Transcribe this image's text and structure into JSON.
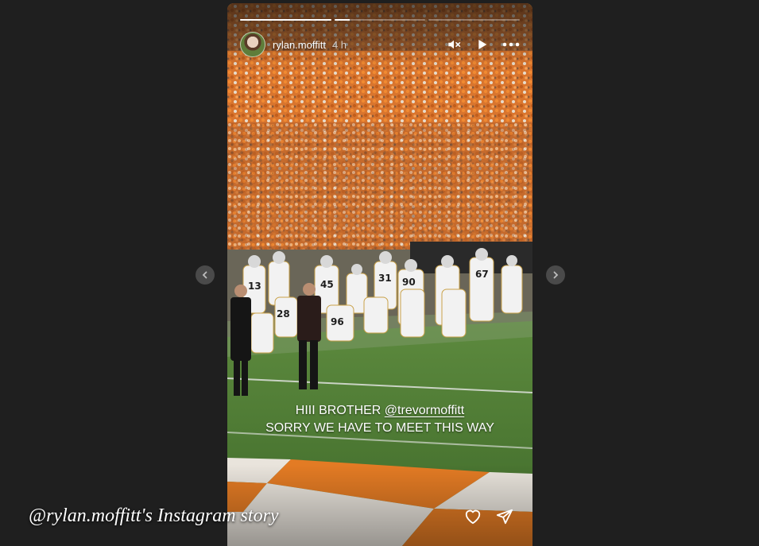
{
  "story": {
    "username": "rylan.moffitt",
    "time_ago": "4 h",
    "segments": [
      {
        "progress": 1.0
      },
      {
        "progress": 0.17
      },
      {
        "progress": 0.0
      }
    ],
    "text_line1_prefix": "HIII BROTHER ",
    "mention": "@trevormoffitt",
    "text_line2": "SORRY WE HAVE TO MEET THIS WAY",
    "jersey_numbers": [
      "13",
      "45",
      "31",
      "90",
      "67",
      "28",
      "96"
    ]
  },
  "icons": {
    "mute": "speaker-muted-icon",
    "play": "play-icon",
    "more": "more-dots-icon",
    "like": "heart-outline-icon",
    "share": "paper-plane-icon",
    "prev": "chevron-left-icon",
    "next": "chevron-right-icon"
  },
  "caption": "@rylan.moffitt's Instagram story",
  "colors": {
    "page_bg": "#1f1f1f",
    "tennessee_orange": "#f07a1e",
    "field_green": "#4e7a34",
    "uniform_white": "#f2f2f2",
    "uniform_gold": "#c9a24a"
  }
}
